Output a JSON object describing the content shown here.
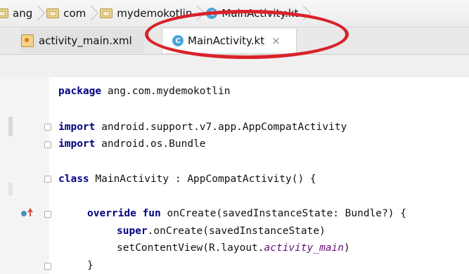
{
  "breadcrumb": {
    "items": [
      {
        "label": "ang",
        "icon": "folder-icon"
      },
      {
        "label": "com",
        "icon": "folder-icon"
      },
      {
        "label": "mydemokotlin",
        "icon": "folder-icon"
      },
      {
        "label": "MainActivity.kt",
        "icon": "kotlin-file-icon"
      }
    ]
  },
  "tabs": [
    {
      "label": "activity_main.xml",
      "icon": "xml-file-icon",
      "active": false
    },
    {
      "label": "MainActivity.kt",
      "icon": "kotlin-file-icon",
      "active": true,
      "close": "×"
    }
  ],
  "code": {
    "package_kw": "package",
    "package_name": " ang.com.mydemokotlin",
    "import1_kw": "import",
    "import1_path": " android.support.v7.app.AppCompatActivity",
    "import2_kw": "import",
    "import2_path": " android.os.Bundle",
    "class_kw": "class",
    "class_rest": " MainActivity : AppCompatActivity() {",
    "override_kw": "override fun",
    "override_rest": " onCreate(savedInstanceState: Bundle?) {",
    "super_kw": "super",
    "super_rest": ".onCreate(savedInstanceState)",
    "setcontent_start": "setContentView(R.layout.",
    "setcontent_italic": "activity_main",
    "setcontent_end": ")",
    "closing_brace": "}"
  },
  "colors": {
    "keyword": "#000080",
    "annotation": "#d9222a",
    "kotlin_icon": "#4aa6d8"
  }
}
